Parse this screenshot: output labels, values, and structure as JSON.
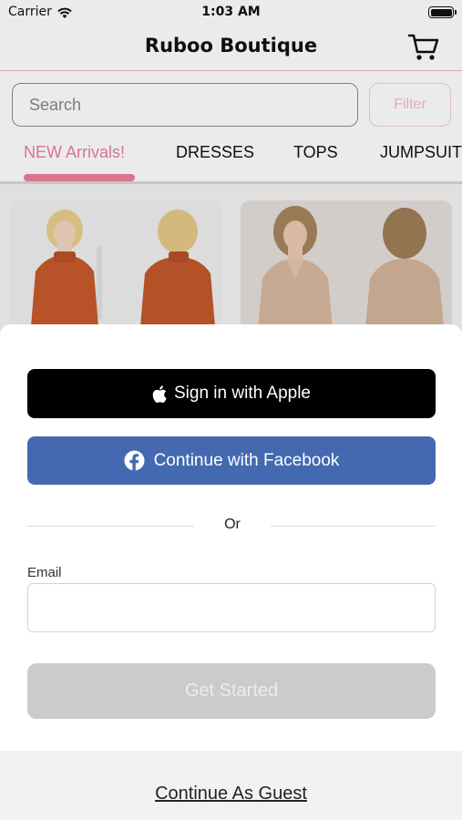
{
  "status_bar": {
    "carrier": "Carrier",
    "time": "1:03 AM",
    "wifi_icon": "wifi-icon",
    "battery_icon": "battery-icon"
  },
  "header": {
    "title": "Ruboo Boutique",
    "cart_icon": "cart-icon"
  },
  "search": {
    "placeholder": "Search",
    "value": "",
    "filter_label": "Filter"
  },
  "tabs": [
    {
      "label": "NEW Arrivals!",
      "active": true
    },
    {
      "label": "DRESSES",
      "active": false
    },
    {
      "label": "TOPS",
      "active": false
    },
    {
      "label": "JUMPSUITS",
      "active": false
    }
  ],
  "products": [
    {
      "image": "rust-mock-neck-top-photo"
    },
    {
      "image": "champagne-satin-blouse-photo"
    }
  ],
  "sign_in": {
    "apple_label": "Sign in with Apple",
    "apple_icon": "apple-icon",
    "facebook_label": "Continue with Facebook",
    "facebook_icon": "facebook-icon",
    "divider_text": "Or",
    "email_label": "Email",
    "email_value": "",
    "get_started_label": "Get Started",
    "guest_label": "Continue As Guest"
  },
  "colors": {
    "accent_pink": "#ee7e9c",
    "facebook_blue": "#4469b0",
    "apple_black": "#000000",
    "disabled_gray": "#cbcbcb"
  }
}
